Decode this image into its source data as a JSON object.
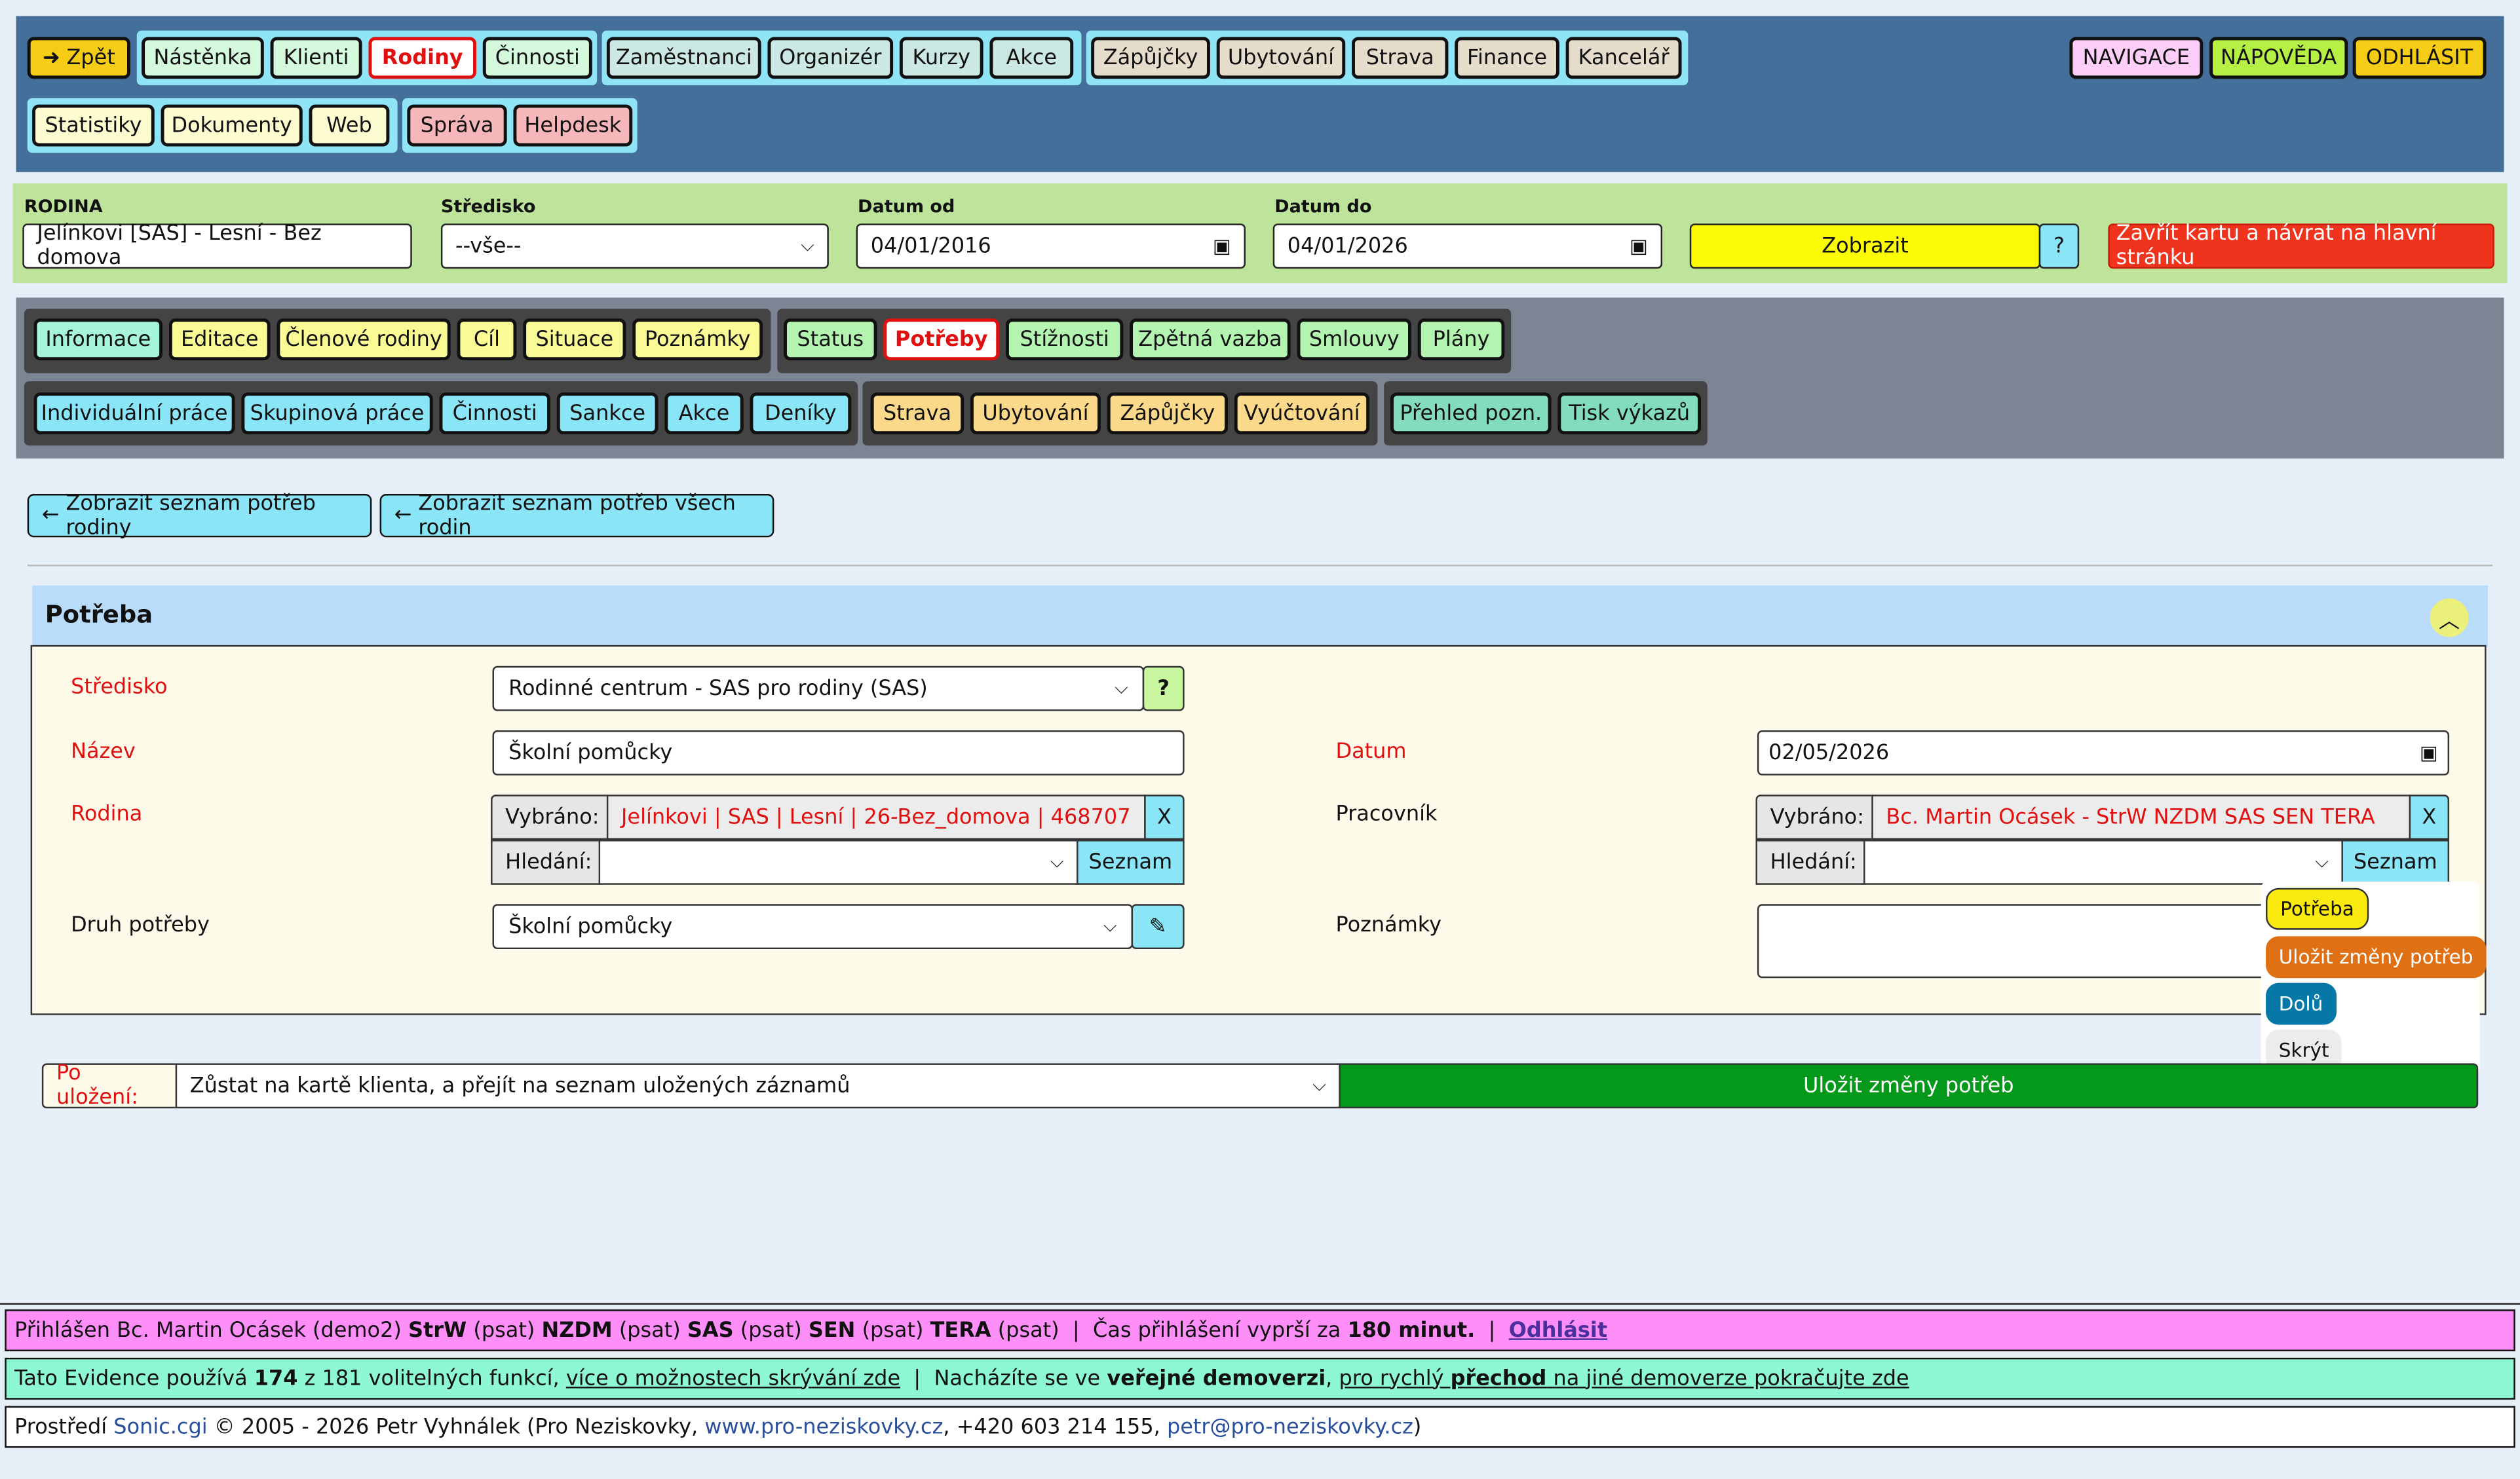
{
  "topnav": {
    "back_label": "Zpět",
    "group1": [
      "Nástěnka",
      "Klienti",
      "Rodiny",
      "Činnosti"
    ],
    "group2": [
      "Zaměstnanci",
      "Organizér",
      "Kurzy",
      "Akce"
    ],
    "group3": [
      "Zápůjčky",
      "Ubytování",
      "Strava",
      "Finance",
      "Kancelář"
    ],
    "group4": [
      "Statistiky",
      "Dokumenty",
      "Web"
    ],
    "group5": [
      "Správa",
      "Helpdesk"
    ],
    "right": [
      "NAVIGACE",
      "NÁPOVĚDA",
      "ODHLÁSIT"
    ],
    "active": "Rodiny"
  },
  "filter": {
    "rodina_label": "RODINA",
    "rodina_value": "Jelínkovi [SAS] - Lesní - Bez domova",
    "stredisko_label": "Středisko",
    "stredisko_value": "--vše--",
    "datum_od_label": "Datum od",
    "datum_od_value": "04/01/2016",
    "datum_do_label": "Datum do",
    "datum_do_value": "04/01/2026",
    "zobrazit_label": "Zobrazit",
    "help_label": "?",
    "close_label": "Zavřít kartu a návrat na hlavní stránku"
  },
  "tabs": {
    "row1a": [
      "Informace",
      "Editace",
      "Členové rodiny",
      "Cíl",
      "Situace",
      "Poznámky"
    ],
    "row1b": [
      "Status",
      "Potřeby",
      "Stížnosti",
      "Zpětná vazba",
      "Smlouvy",
      "Plány"
    ],
    "row2a": [
      "Individuální práce",
      "Skupinová práce",
      "Činnosti",
      "Sankce",
      "Akce",
      "Deníky"
    ],
    "row2b": [
      "Strava",
      "Ubytování",
      "Zápůjčky",
      "Vyúčtování"
    ],
    "row2c": [
      "Přehled pozn.",
      "Tisk výkazů"
    ],
    "active": "Potřeby"
  },
  "links": {
    "family_needs": "Zobrazit seznam potřeb rodiny",
    "all_needs": "Zobrazit seznam potřeb všech rodin"
  },
  "panel": {
    "title": "Potřeba",
    "stredisko_label": "Středisko",
    "stredisko_value": "Rodinné centrum - SAS pro rodiny (SAS)",
    "stredisko_help": "?",
    "nazev_label": "Název",
    "nazev_value": "Školní pomůcky",
    "datum_label": "Datum",
    "datum_value": "02/05/2026",
    "rodina_label": "Rodina",
    "vybrano_label": "Vybráno:",
    "rodina_selected": "Jelínkovi | SAS | Lesní | 26-Bez_domova | 468707",
    "clear_label": "X",
    "hledani_label": "Hledání:",
    "seznam_label": "Seznam",
    "pracovnik_label": "Pracovník",
    "pracovnik_selected": "Bc. Martin Ocásek - StrW NZDM SAS SEN TERA",
    "druh_label": "Druh potřeby",
    "druh_value": "Školní pomůcky",
    "poznamky_label": "Poznámky"
  },
  "floatmenu": {
    "potreba": "Potřeba",
    "ulozit": "Uložit změny potřeb",
    "dolu": "Dolů",
    "skryt": "Skrýt"
  },
  "save": {
    "po_ulozeni_label": "Po uložení:",
    "po_ulozeni_value": "Zůstat na kartě klienta, a přejít na seznam uložených záznamů",
    "save_label": "Uložit změny potřeb"
  },
  "footer1": {
    "prefix": "Přihlášen Bc. Martin Ocásek (demo2)",
    "roles": [
      {
        "name": "StrW",
        "rest": "(psat)"
      },
      {
        "name": "NZDM",
        "rest": "(psat)"
      },
      {
        "name": "SAS",
        "rest": "(psat)"
      },
      {
        "name": "SEN",
        "rest": "(psat)"
      },
      {
        "name": "TERA",
        "rest": "(psat)"
      }
    ],
    "sep": "|",
    "expire_text": "Čas přihlášení vyprší za",
    "expire_value": "180 minut.",
    "logout": "Odhlásit"
  },
  "footer2": {
    "t1": "Tato Evidence používá",
    "count": "174",
    "t2": "z 181 volitelných funkcí,",
    "link1": "více o možnostech skrývání zde",
    "sep": "|",
    "t3": "Nacházíte se ve",
    "t4": "veřejné demoverzi",
    "t5": ",",
    "link2a": "pro rychlý",
    "link2b": "přechod",
    "link2c": "na jiné demoverze pokračujte zde"
  },
  "footer3": {
    "t1": "Prostředí",
    "sonic": "Sonic.cgi",
    "t2": "© 2005 - 2026 Petr Vyhnálek (Pro Neziskovky,",
    "site": "www.pro-neziskovky.cz",
    "t3": ", +420 603 214 155,",
    "email": "petr@pro-neziskovky.cz",
    "t4": ")"
  },
  "colors": {
    "nav_bg": "#456f9b",
    "filter_bg": "#bde49a",
    "tabs_bg": "#7d8595",
    "active_red": "#e01010",
    "save_green": "#05991b",
    "footer_pink": "#fe8ef8",
    "footer_green": "#8ef8d2"
  }
}
